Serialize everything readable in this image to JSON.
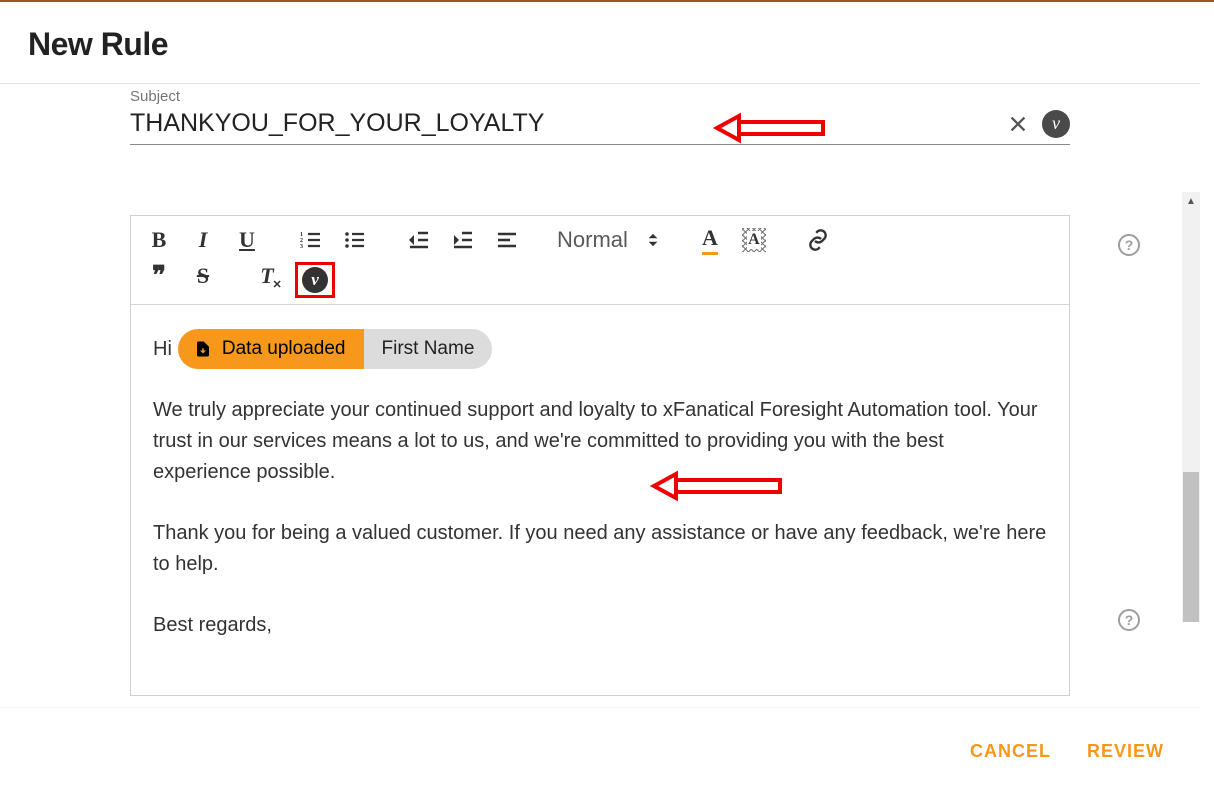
{
  "dialog": {
    "title": "New Rule"
  },
  "subject": {
    "label": "Subject",
    "value": "THANKYOU_FOR_YOUR_LOYALTY"
  },
  "toolbar": {
    "fontsize_label": "Normal"
  },
  "body": {
    "greet": "Hi",
    "chip_source": "Data uploaded",
    "chip_field": "First Name",
    "p1": "We truly appreciate your continued support and loyalty to xFanatical Foresight Automation tool. Your trust in our services means a lot to us, and we're committed to providing you with the best experience possible.",
    "p2": "Thank you for being a valued customer. If you need any assistance or have any feedback, we're here to help.",
    "p3": "Best regards,"
  },
  "footer": {
    "cancel": "CANCEL",
    "review": "REVIEW"
  },
  "help_glyph": "?",
  "variable_glyph": "v"
}
